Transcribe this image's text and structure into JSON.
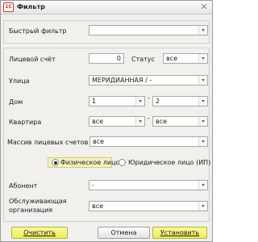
{
  "window": {
    "title": "Фильтр",
    "app_icon_text": "1С"
  },
  "quick_filter": {
    "label": "Быстрый фильтр",
    "value": ""
  },
  "account": {
    "label": "Лицевой счёт",
    "value": "0"
  },
  "status": {
    "label": "Статус",
    "value": "все"
  },
  "street": {
    "label": "Улица",
    "value": "МЕРИДИАННАЯ / -"
  },
  "house": {
    "label": "Дом",
    "from": "1",
    "to": "2",
    "separator": "-"
  },
  "apartment": {
    "label": "Квартира",
    "from": "все",
    "to": "все",
    "separator": "-"
  },
  "accounts_array": {
    "label": "Массив лицевых счетов",
    "value": "все"
  },
  "person_type": {
    "options": [
      "Физическое лицо",
      "Юридическое лицо (ИП)"
    ],
    "selected": "Физическое лицо"
  },
  "subscriber": {
    "label": "Абонент",
    "value": "-"
  },
  "service_org": {
    "label_line1": "Обслуживающая",
    "label_line2": "организация",
    "value": "все"
  },
  "buttons": {
    "clear": "Очистить",
    "cancel": "Отмена",
    "apply": "Установить"
  }
}
